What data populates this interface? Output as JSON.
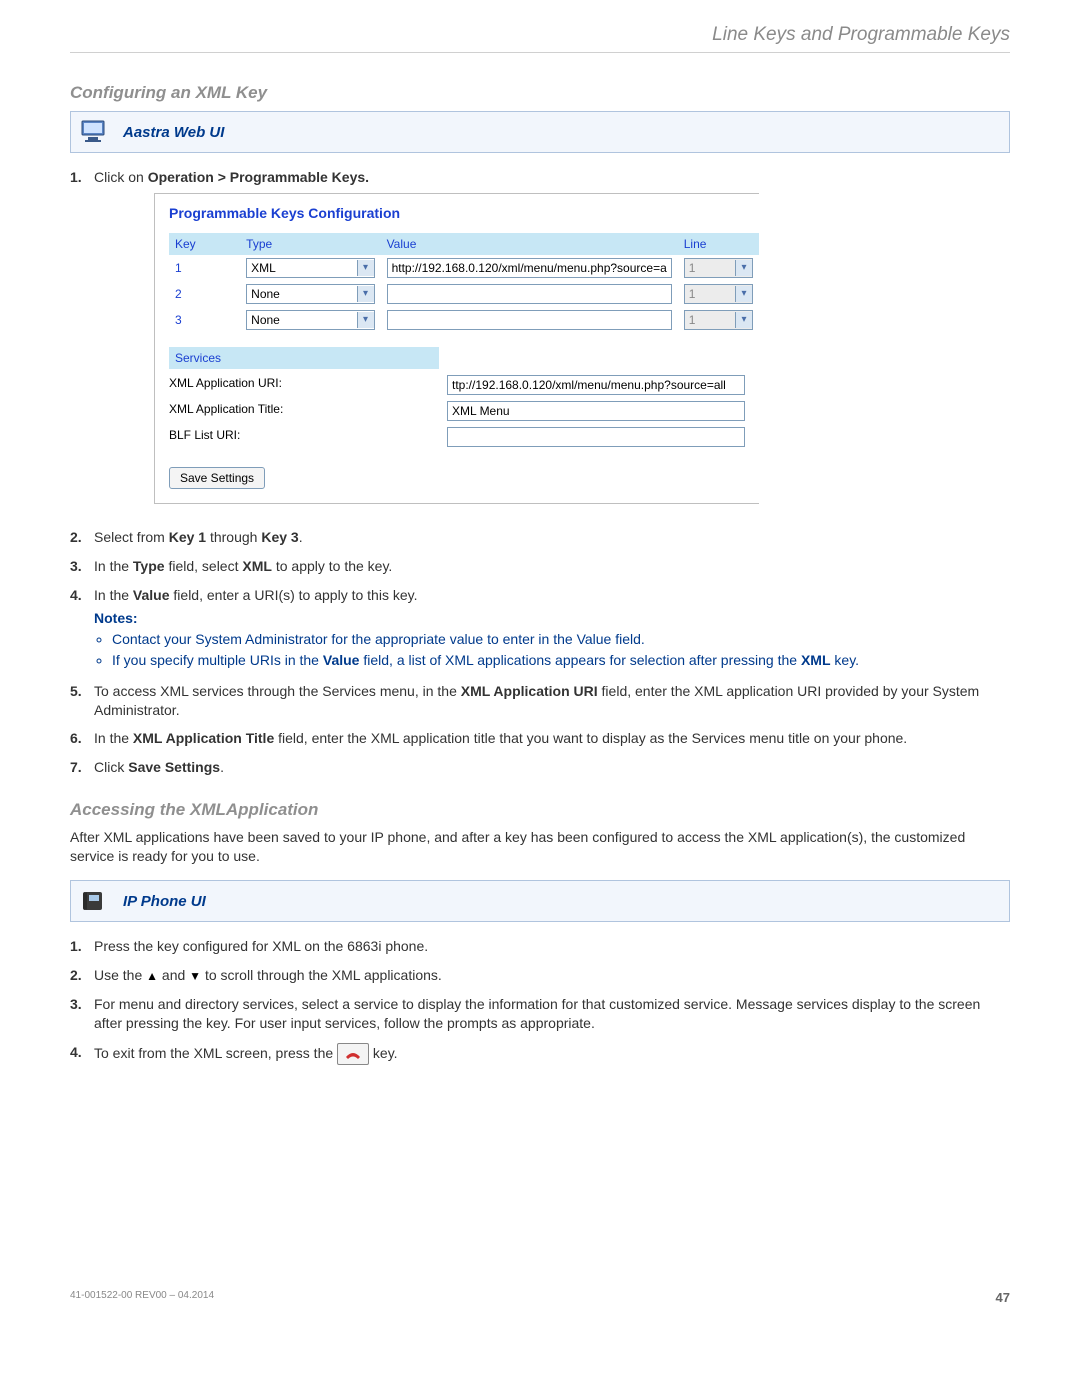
{
  "header": {
    "running": "Line Keys and Programmable Keys"
  },
  "section1": {
    "title": "Configuring an XML Key",
    "uiLabel": "Aastra Web UI"
  },
  "steps1": {
    "s1_pre": "Click on ",
    "s1_bold": "Operation > Programmable Keys.",
    "s2_a": "Select from ",
    "s2_b1": "Key 1",
    "s2_b": " through ",
    "s2_b2": "Key 3",
    "s2_c": ".",
    "s3_a": "In the ",
    "s3_b1": "Type",
    "s3_b": " field, select ",
    "s3_b2": "XML",
    "s3_c": " to apply to the key.",
    "s4_a": "In the ",
    "s4_b1": "Value",
    "s4_b": " field, enter a URI(s) to apply to this key.",
    "notesLabel": "Notes:",
    "note1": "Contact your System Administrator for the appropriate value to enter in the Value field.",
    "note2_a": "If you specify multiple URIs in the ",
    "note2_b1": "Value",
    "note2_b": " field, a list of XML applications appears for selection after pressing the ",
    "note2_b2": "XML",
    "note2_c": " key.",
    "s5_a": "To access XML services through the Services menu, in the ",
    "s5_b1": "XML Application URI",
    "s5_b": " field, enter the XML application URI provided by your System Administrator.",
    "s6_a": "In the ",
    "s6_b1": "XML Application Title",
    "s6_b": " field, enter the XML application title that you want to display as the Services menu title on your phone.",
    "s7_a": "Click ",
    "s7_b1": "Save Settings",
    "s7_b": "."
  },
  "embed": {
    "title": "Programmable Keys Configuration",
    "cols": {
      "key": "Key",
      "type": "Type",
      "value": "Value",
      "line": "Line"
    },
    "rows": [
      {
        "key": "1",
        "type": "XML",
        "value": "http://192.168.0.120/xml/menu/menu.php?source=a",
        "line": "1",
        "lineEnabled": false
      },
      {
        "key": "2",
        "type": "None",
        "value": "",
        "line": "1",
        "lineEnabled": false
      },
      {
        "key": "3",
        "type": "None",
        "value": "",
        "line": "1",
        "lineEnabled": false
      }
    ],
    "servicesHead": "Services",
    "svc": [
      {
        "label": "XML Application URI:",
        "value": "ttp://192.168.0.120/xml/menu/menu.php?source=all"
      },
      {
        "label": "XML Application Title:",
        "value": "XML Menu"
      },
      {
        "label": "BLF List URI:",
        "value": ""
      }
    ],
    "saveBtn": "Save Settings"
  },
  "section2": {
    "title": "Accessing the XMLApplication",
    "para": "After XML applications have been saved to your IP phone, and after a key has been configured to access the XML application(s), the customized service is ready for you to use.",
    "uiLabel": "IP Phone UI"
  },
  "steps2": {
    "s1": "Press the key configured for XML on the 6863i phone.",
    "s2_a": "Use the ",
    "s2_b": " and ",
    "s2_c": " to scroll through the XML applications.",
    "s3": "For menu and directory services, select a service to display the information for that customized service. Message services display to the screen after pressing the key. For user input services, follow the prompts as appropriate.",
    "s4_a": "To exit from the XML screen, press the ",
    "s4_b": " key."
  },
  "footer": {
    "doc": "41-001522-00 REV00 – 04.2014",
    "page": "47"
  }
}
